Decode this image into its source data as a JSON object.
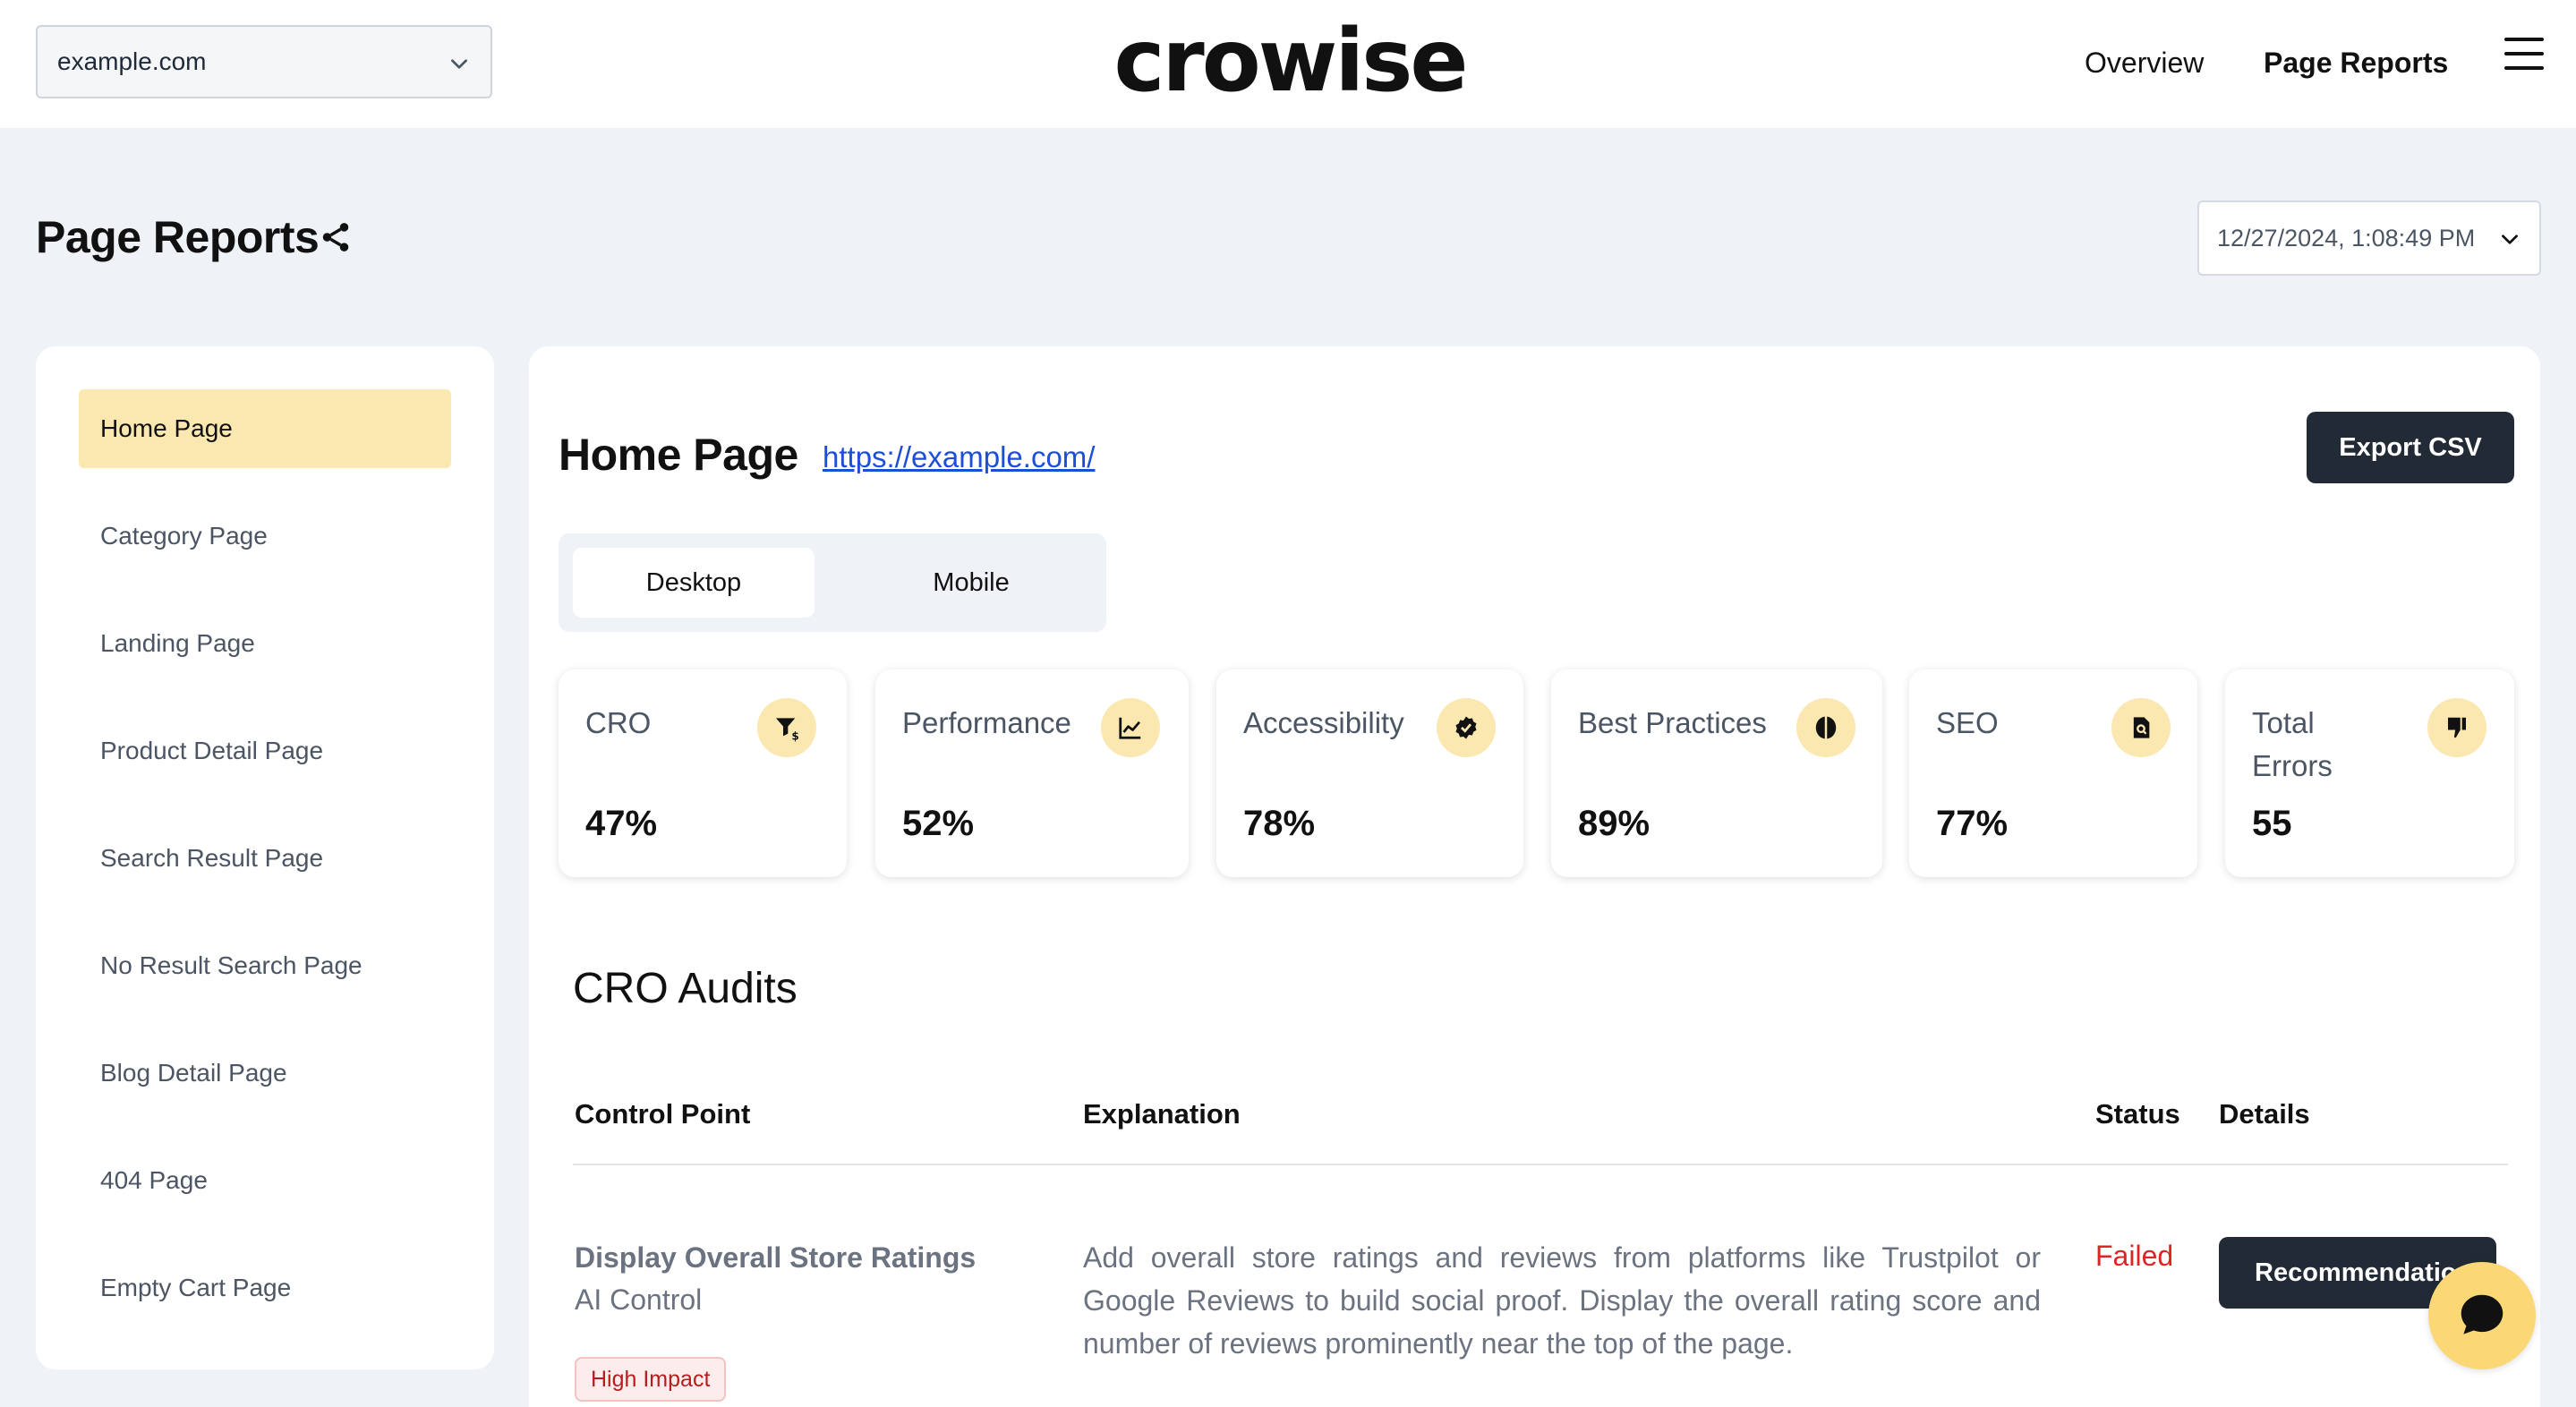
{
  "header": {
    "site_select": {
      "value": "example.com"
    },
    "logo": "crowise",
    "nav": {
      "overview": "Overview",
      "page_reports": "Page Reports"
    },
    "menu_icon": "hamburger-menu-icon"
  },
  "title_row": {
    "title": "Page Reports",
    "share_icon": "share-icon",
    "date_select": {
      "value": "12/27/2024, 1:08:49 PM"
    }
  },
  "sidebar": {
    "items": [
      {
        "label": "Home Page",
        "active": true
      },
      {
        "label": "Category Page"
      },
      {
        "label": "Landing Page"
      },
      {
        "label": "Product Detail Page"
      },
      {
        "label": "Search Result Page"
      },
      {
        "label": "No Result Search Page"
      },
      {
        "label": "Blog Detail Page"
      },
      {
        "label": "404 Page"
      },
      {
        "label": "Empty Cart Page"
      }
    ]
  },
  "main": {
    "title": "Home Page",
    "url": "https://example.com/",
    "export_label": "Export CSV",
    "tabs": [
      {
        "label": "Desktop",
        "active": true
      },
      {
        "label": "Mobile"
      }
    ],
    "metrics": [
      {
        "label": "CRO",
        "value": "47%",
        "icon": "funnel-dollar-icon"
      },
      {
        "label": "Performance",
        "value": "52%",
        "icon": "chart-line-icon"
      },
      {
        "label": "Accessibility",
        "value": "78%",
        "icon": "badge-check-icon"
      },
      {
        "label": "Best Practices",
        "value": "89%",
        "icon": "brain-icon"
      },
      {
        "label": "SEO",
        "value": "77%",
        "icon": "file-search-icon"
      },
      {
        "label": "Total Errors",
        "value": "55",
        "icon": "thumbs-down-icon"
      }
    ],
    "audits": {
      "title": "CRO Audits",
      "columns": {
        "control_point": "Control Point",
        "explanation": "Explanation",
        "status": "Status",
        "details": "Details"
      },
      "rows": [
        {
          "control_point": "Display Overall Store Ratings",
          "type": "AI Control",
          "impact": "High Impact",
          "explanation": "Add overall store ratings and reviews from platforms like Trustpilot or Google Reviews to build social proof. Display the overall rating score and number of reviews prominently near the top of the page.",
          "status": "Failed",
          "details_label": "Recommendation"
        }
      ]
    }
  },
  "chat": {
    "icon": "chat-bubble-icon"
  },
  "colors": {
    "accent": "#fbe8b0",
    "dark_button": "#222a35",
    "failed": "#dc2626",
    "link": "#1d4ed8"
  }
}
